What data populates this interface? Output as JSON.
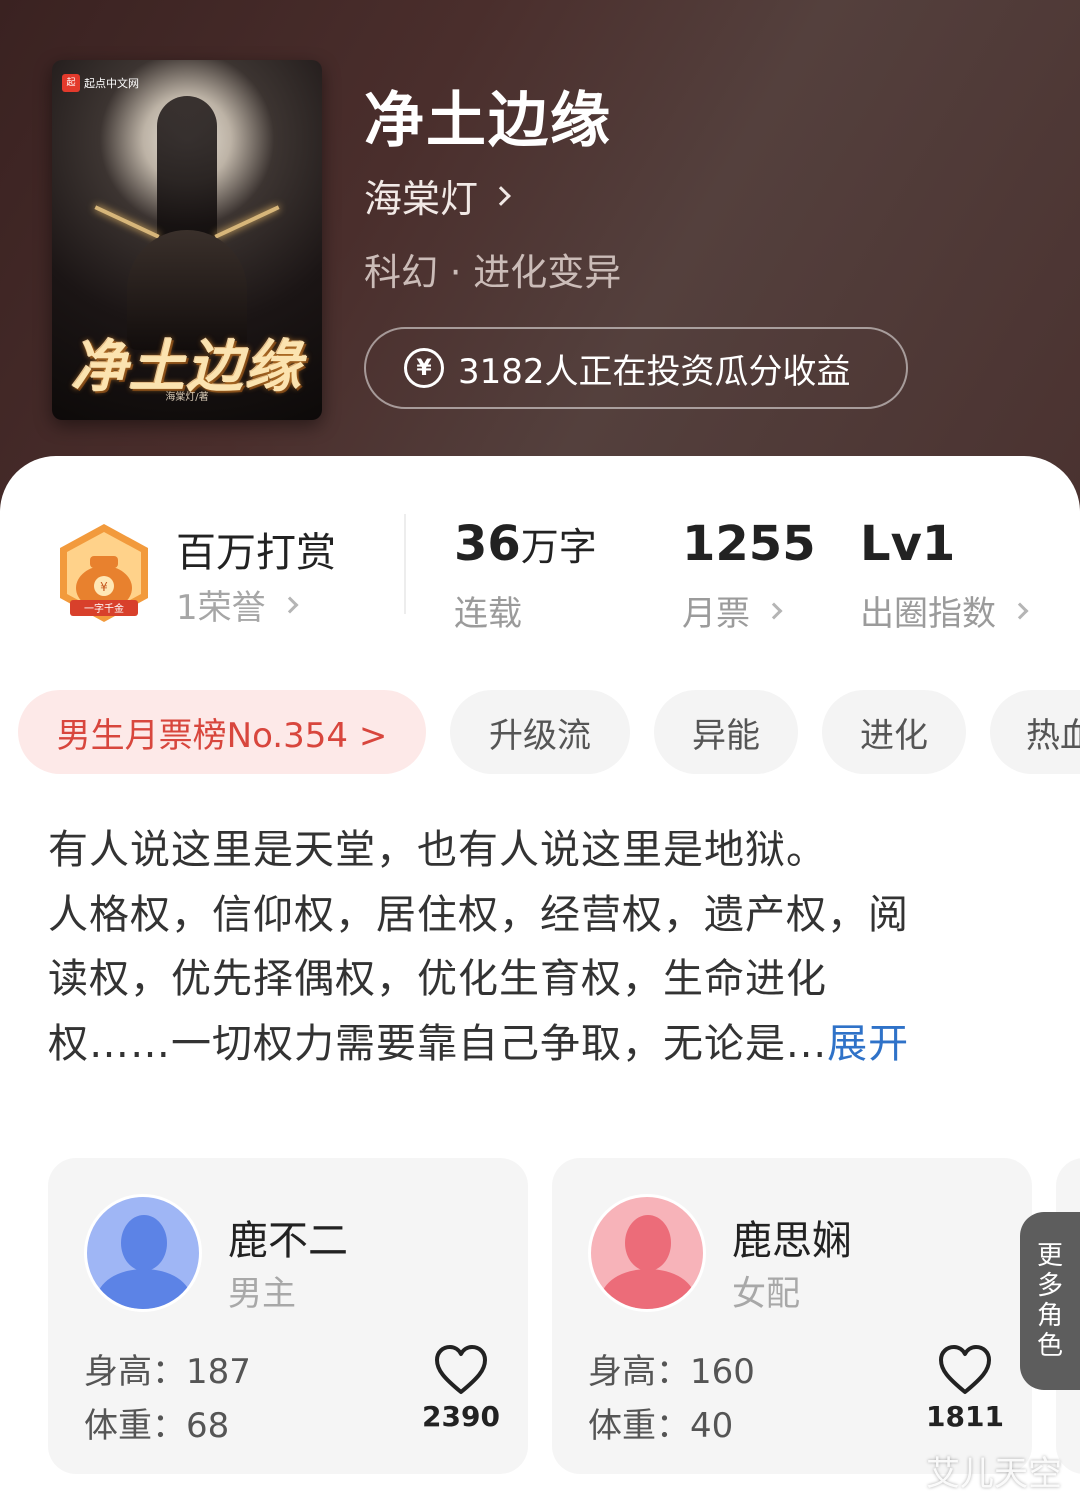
{
  "book": {
    "title": "净土边缘",
    "author": "海棠灯",
    "genre": "科幻 · 进化变异",
    "invest_text": "3182人正在投资瓜分收益",
    "cover": {
      "publisher": "起点中文网",
      "publisher_logo": "起",
      "title_art": "净土边缘",
      "author_art": "海棠灯/著"
    }
  },
  "honor": {
    "name": "百万打赏",
    "sub": "1荣誉",
    "badge_label": "一字千金",
    "badge_icon": "money-bag-icon"
  },
  "stats": [
    {
      "value": "36",
      "unit": "万字",
      "label": "连载"
    },
    {
      "value": "1255",
      "unit": "",
      "label": "月票"
    },
    {
      "value": "Lv1",
      "unit": "",
      "label": "出圈指数"
    }
  ],
  "tags": {
    "rank": "男生月票榜No.354 >",
    "items": [
      "升级流",
      "异能",
      "进化",
      "热血"
    ]
  },
  "synopsis": {
    "lines": [
      "有人说这里是天堂，也有人说这里是地狱。",
      "人格权，信仰权，居住权，经营权，遗产权，阅",
      "读权，优先择偶权，优化生育权，生命进化",
      "权……一切权力需要靠自己争取，无论是..."
    ],
    "expand": "展开"
  },
  "characters": [
    {
      "name": "鹿不二",
      "role": "男主",
      "height": "身高：187",
      "weight": "体重：68",
      "likes": "2390",
      "avatar_color": "#7b9ef0"
    },
    {
      "name": "鹿思娴",
      "role": "女配",
      "height": "身高：160",
      "weight": "体重：40",
      "likes": "1811",
      "avatar_color": "#f08a94"
    }
  ],
  "more_roles": [
    "更",
    "多",
    "角",
    "色"
  ],
  "watermark": "艾儿天空",
  "colors": {
    "header_bg": "#4a2e2c",
    "rank_tag_text": "#d8463d",
    "rank_tag_bg": "#fde9e8",
    "expand_link": "#2f72c8"
  }
}
